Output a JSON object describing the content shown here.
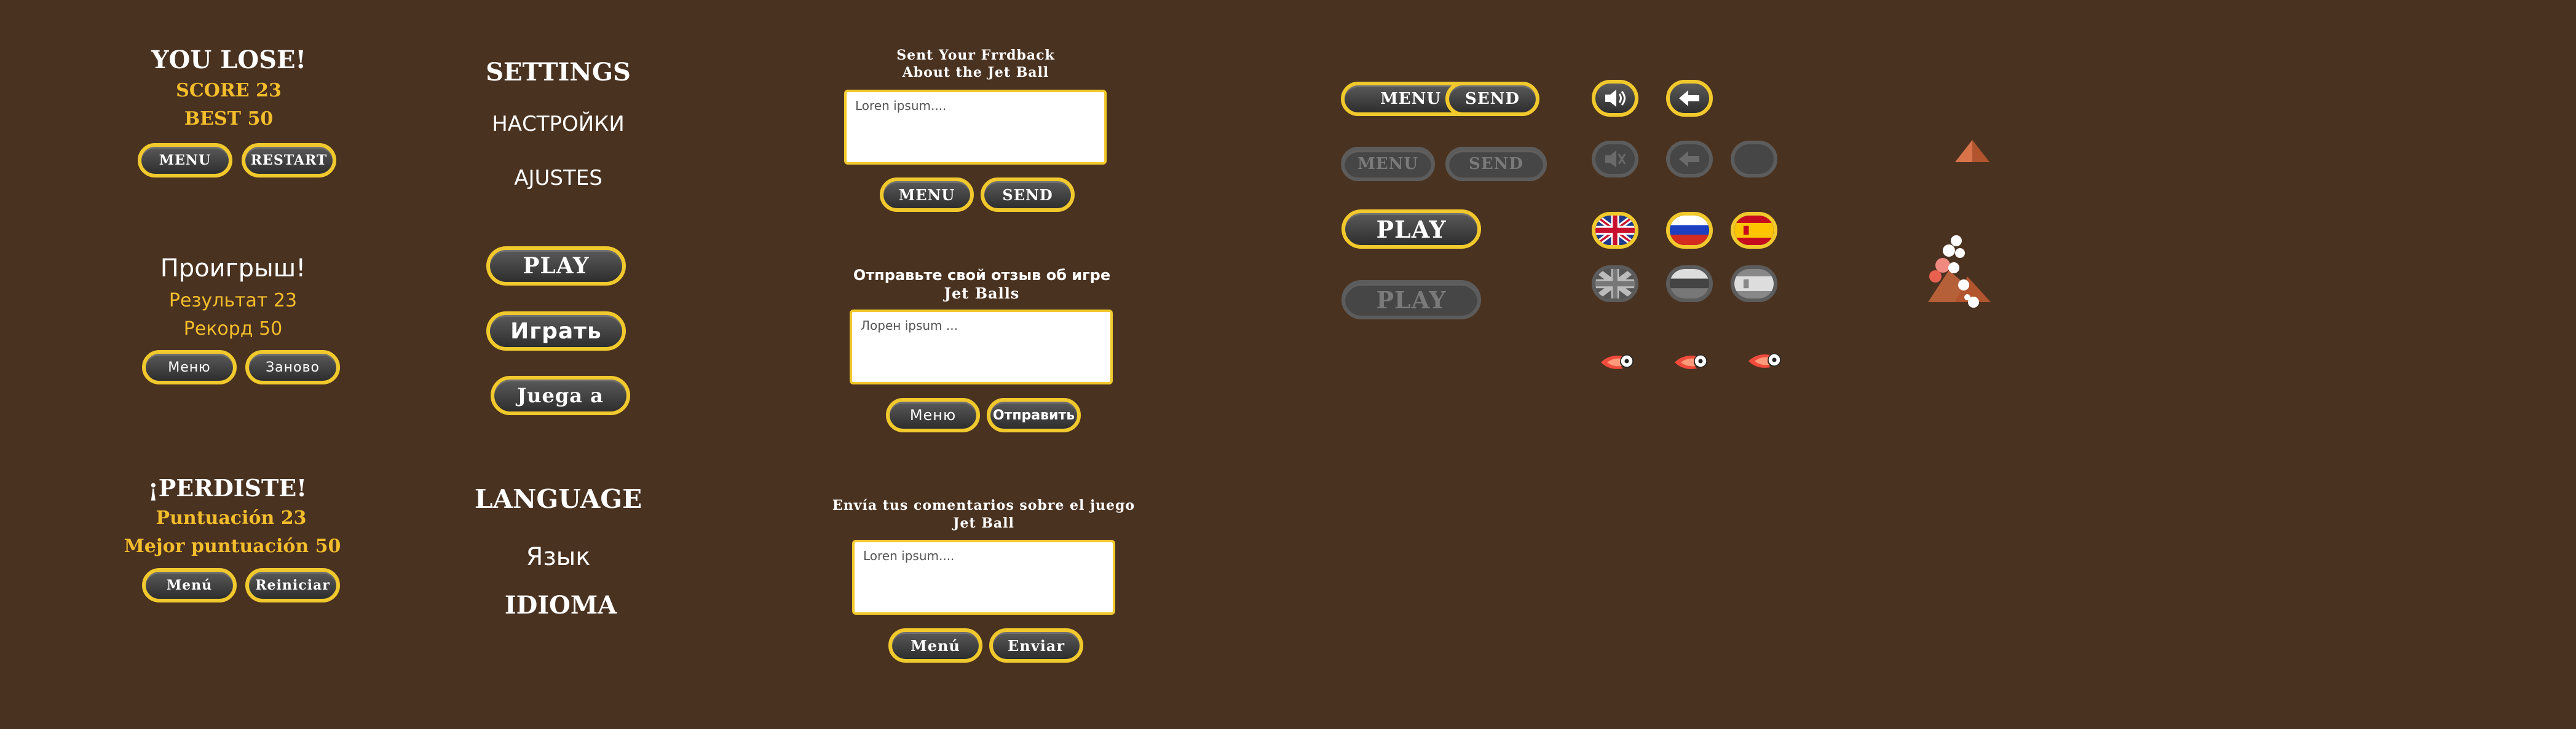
{
  "lose_en": {
    "title": "YOU LOSE!",
    "score": "SCORE 23",
    "best": "BEST 50",
    "menu": "MENU",
    "restart": "RESTART"
  },
  "lose_ru": {
    "title": "Проигрыш!",
    "score": "Результат 23",
    "best": "Рекорд 50",
    "menu": "Меню",
    "restart": "Заново"
  },
  "lose_es": {
    "title": "¡PERDISTE!",
    "score": "Puntuación 23",
    "best": "Mejor puntuación 50",
    "menu": "Menú",
    "restart": "Reiniciar"
  },
  "settings": {
    "en": "SETTINGS",
    "ru": "НАСТРОЙКИ",
    "es": "AJUSTES"
  },
  "play": {
    "en": "PLAY",
    "ru": "Играть",
    "es": "Juega a"
  },
  "language": {
    "en": "LANGUAGE",
    "ru": "Язык",
    "es": "IDIOMA"
  },
  "feedback_en": {
    "title1": "Sent Your Frrdback",
    "title2": "About the Jet Ball",
    "text": "Loren ipsum....",
    "menu": "MENU",
    "send": "SEND"
  },
  "feedback_ru": {
    "title1": "Отправьте свой отзыв об игре",
    "title2": "Jet Balls",
    "text": "Лорен ipsum ...",
    "menu": "Меню",
    "send": "Отправить"
  },
  "feedback_es": {
    "title1": "Envía tus comentarios sobre el juego",
    "title2": "Jet Ball",
    "text": "Loren ipsum....",
    "menu": "Menú",
    "send": "Enviar"
  },
  "buttons": {
    "menu": "MENU",
    "send": "SEND",
    "play": "PLAY"
  },
  "icons": {
    "sound": "speaker-icon",
    "sound_muted": "speaker-muted-icon",
    "back": "arrow-left-icon",
    "ball": "flaming-soccer-ball-icon",
    "tri": "triangle-marker-icon"
  },
  "colors": {
    "background": "#4a3220",
    "gold": "#f3bd2c",
    "button_border": "#f2c92d",
    "button_fill": "#3c3c3c",
    "disabled_border": "#5c5c5c"
  }
}
